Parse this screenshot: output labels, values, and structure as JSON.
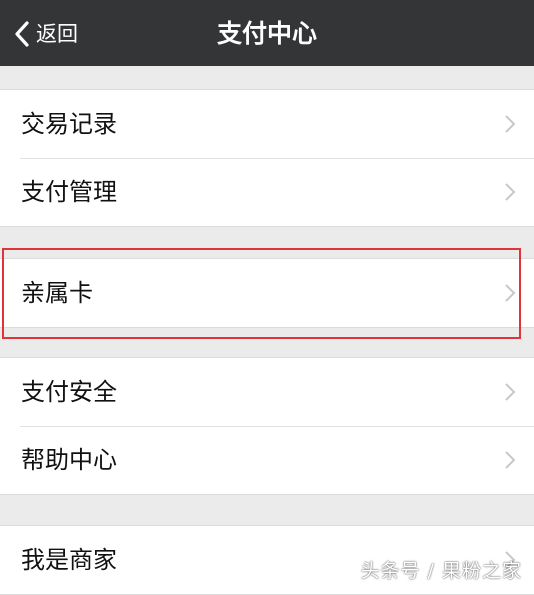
{
  "navbar": {
    "back_label": "返回",
    "title": "支付中心"
  },
  "groups": [
    {
      "items": [
        {
          "label": "交易记录"
        },
        {
          "label": "支付管理"
        }
      ]
    },
    {
      "items": [
        {
          "label": "亲属卡",
          "highlighted": true
        }
      ]
    },
    {
      "items": [
        {
          "label": "支付安全"
        },
        {
          "label": "帮助中心"
        }
      ]
    },
    {
      "items": [
        {
          "label": "我是商家"
        }
      ]
    }
  ],
  "watermark": "头条号 / 果粉之家",
  "colors": {
    "navbar_bg": "#333537",
    "page_bg": "#ebebeb",
    "highlight_border": "#e0343a",
    "chevron": "#c7c7cc"
  }
}
